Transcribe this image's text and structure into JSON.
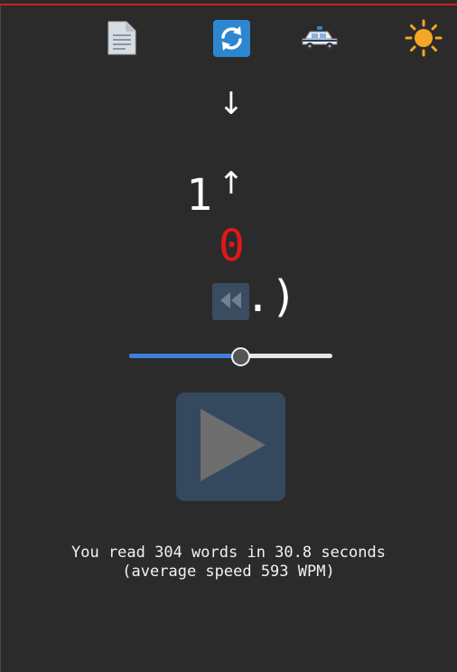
{
  "toolbar": {
    "items": [
      {
        "icon": "document-icon",
        "label": ""
      },
      {
        "icon": "reload-icon",
        "label": ""
      },
      {
        "icon": "police-car-icon",
        "label": ""
      },
      {
        "icon": "sun-icon",
        "label": ""
      }
    ]
  },
  "reader": {
    "arrow_down": "↓",
    "arrow_up": "↑",
    "word_pre": "1",
    "word_focus": "0",
    "word_post": ".)"
  },
  "controls": {
    "speed_fraction": 0.545
  },
  "stats": {
    "line1": "You read 304 words in 30.8 seconds",
    "line2": "(average speed 593 WPM)"
  },
  "colors": {
    "background": "#2b2b2b",
    "accent_red": "#e01818",
    "button_blue": "#34495e",
    "slider_fill": "#3f7fd9"
  }
}
